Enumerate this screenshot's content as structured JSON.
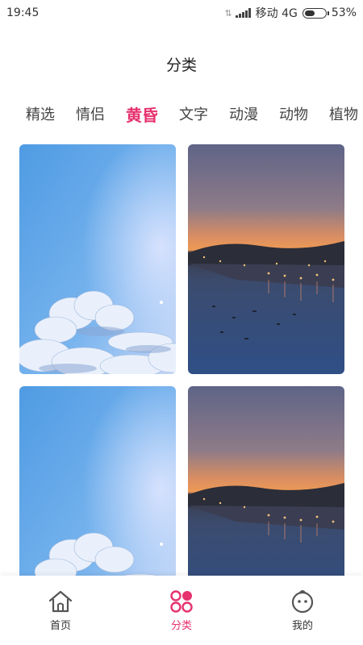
{
  "status_bar": {
    "time": "19:45",
    "carrier": "移动 4G",
    "battery": "53%",
    "battery_level": 0.53
  },
  "header": {
    "title": "分类"
  },
  "tabs": [
    {
      "label": "精选",
      "active": false
    },
    {
      "label": "情侣",
      "active": false
    },
    {
      "label": "黄昏",
      "active": true
    },
    {
      "label": "文字",
      "active": false
    },
    {
      "label": "动漫",
      "active": false
    },
    {
      "label": "动物",
      "active": false
    },
    {
      "label": "植物",
      "active": false
    }
  ],
  "wallpapers": [
    {
      "name": "sky-clouds"
    },
    {
      "name": "sunset-harbor"
    },
    {
      "name": "sky-clouds"
    },
    {
      "name": "sunset-harbor"
    }
  ],
  "bottom_nav": [
    {
      "label": "首页",
      "icon": "home-icon",
      "active": false
    },
    {
      "label": "分类",
      "icon": "category-icon",
      "active": true
    },
    {
      "label": "我的",
      "icon": "profile-icon",
      "active": false
    }
  ],
  "colors": {
    "accent": "#e6326e",
    "text": "#333333",
    "inactive_icon": "#555555"
  }
}
